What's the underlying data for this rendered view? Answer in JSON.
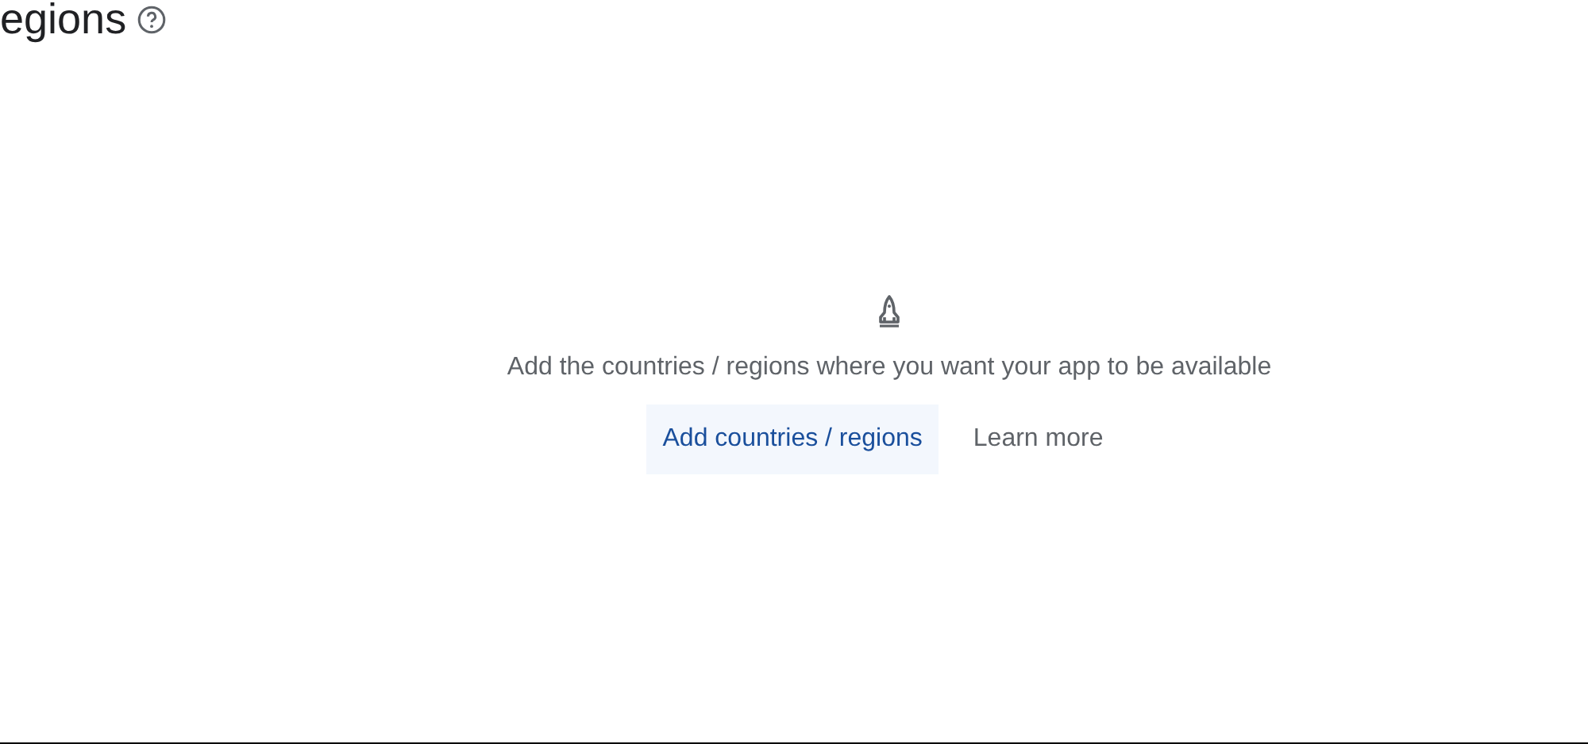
{
  "page": {
    "title": "egions"
  },
  "empty_state": {
    "message": "Add the countries / regions where you want your app to be available",
    "buttons": [
      {
        "label": "Add countries / regions",
        "kind": "tonal"
      },
      {
        "label": "Learn more",
        "kind": "text"
      }
    ]
  }
}
